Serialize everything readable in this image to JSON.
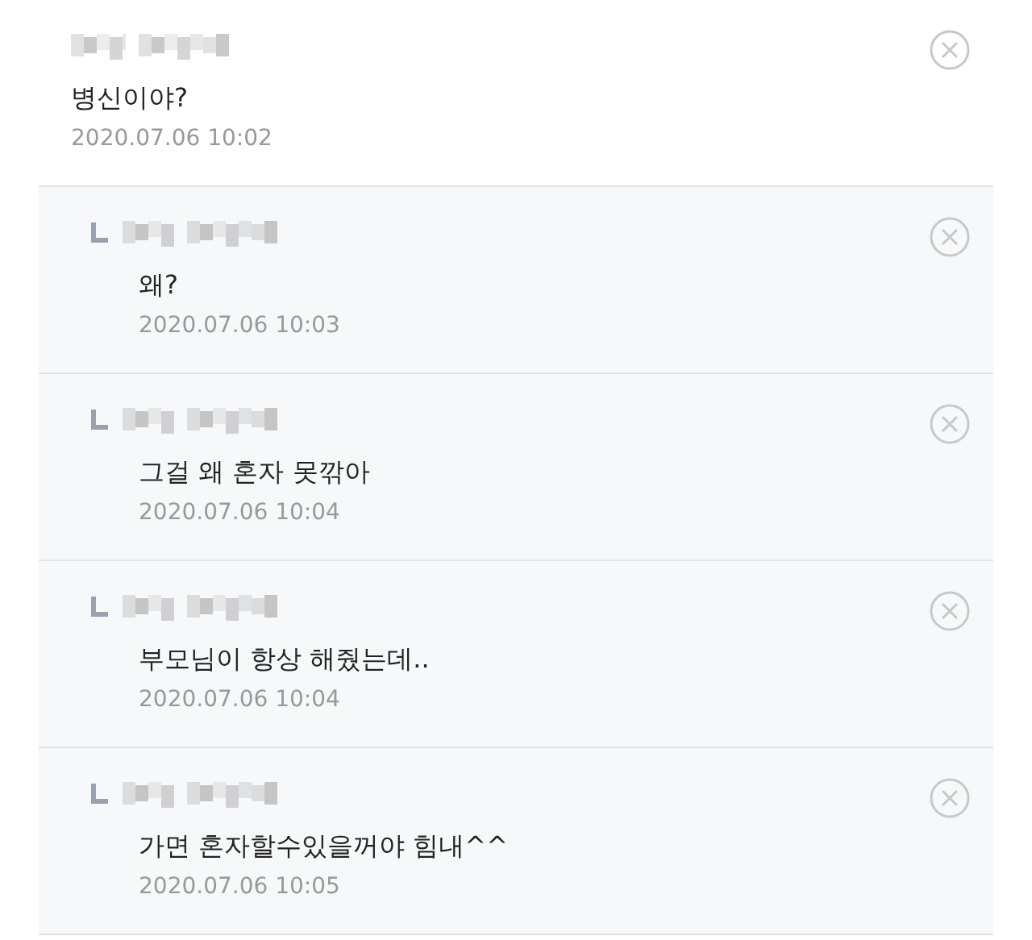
{
  "comments": [
    {
      "kind": "comment",
      "text": "병신이야?",
      "time": "2020.07.06 10:02"
    },
    {
      "kind": "reply",
      "text": "왜?",
      "time": "2020.07.06 10:03"
    },
    {
      "kind": "reply",
      "text": "그걸 왜 혼자 못깎아",
      "time": "2020.07.06 10:04"
    },
    {
      "kind": "reply",
      "text": "부모님이 항상 해줬는데..",
      "time": "2020.07.06 10:04"
    },
    {
      "kind": "reply",
      "text": "가면 혼자할수있을꺼야 힘내^^",
      "time": "2020.07.06 10:05"
    }
  ]
}
